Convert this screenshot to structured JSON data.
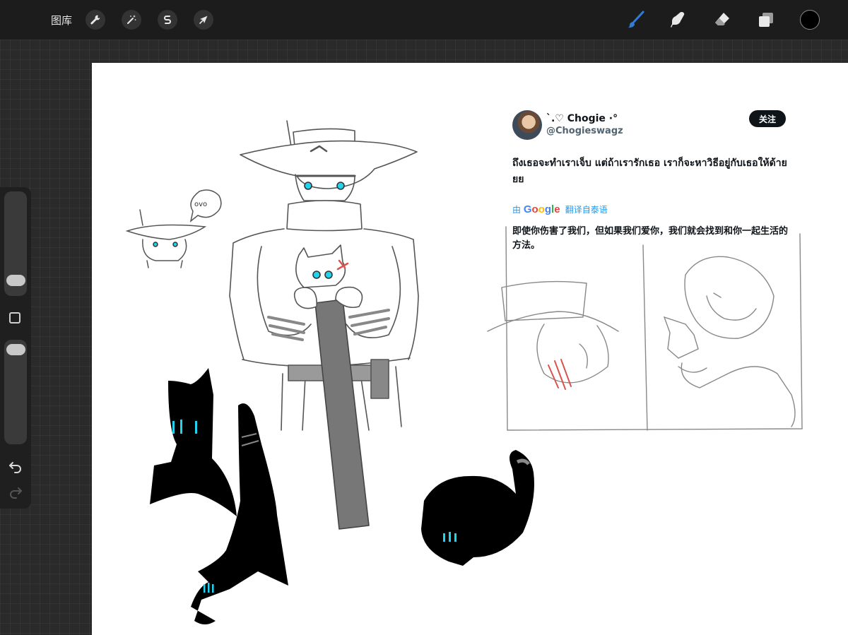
{
  "toolbar": {
    "gallery_label": "图库",
    "left_tools": [
      {
        "name": "actions",
        "icon": "wrench-icon"
      },
      {
        "name": "adjustments",
        "icon": "magic-wand-icon"
      },
      {
        "name": "selection",
        "icon": "selection-s-icon"
      },
      {
        "name": "transform",
        "icon": "arrow-cursor-icon"
      }
    ],
    "right_tools": [
      {
        "name": "brush",
        "icon": "brush-icon",
        "active": true
      },
      {
        "name": "smudge",
        "icon": "smudge-finger-icon"
      },
      {
        "name": "eraser",
        "icon": "eraser-icon"
      },
      {
        "name": "layers",
        "icon": "layers-icon"
      }
    ],
    "current_color": "#000000",
    "active_color": "#2f7dd8"
  },
  "sidebar": {
    "brush_size_level": 0.18,
    "opacity_level": 0.95
  },
  "tweet": {
    "display_name": "`.♡ Chogie ·°",
    "handle": "@Chogieswagz",
    "follow_label": "关注",
    "text": "ถึงเธอจะทำเราเจ็บ แต่ถ้าเรารักเธอ เราก็จะหาวิธีอยู่กับเธอให้ด้ายยย",
    "translate_by": "由",
    "translate_brand": "Google",
    "translate_label": "翻译自泰语",
    "translated_text": "即使你伤害了我们，但如果我们爱你，我们就会找到和你一起生活的方法。"
  },
  "drawing": {
    "speech_bubble": "ovo"
  },
  "colors": {
    "accent_cyan": "#22d3ee",
    "sketch_gray": "#808080",
    "scratch_red": "#d9534f",
    "tweet_link_blue": "#1d9bf0"
  }
}
